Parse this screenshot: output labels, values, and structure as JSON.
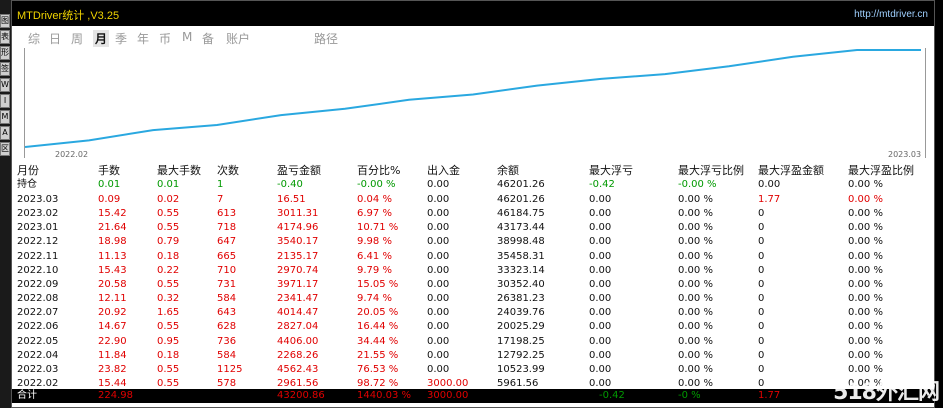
{
  "app": {
    "title": "MTDriver统计 ,V3.25",
    "url": "http://mtdriver.cn"
  },
  "left_strip": [
    "图",
    "表",
    "形",
    "签",
    "W",
    "I",
    "M",
    "A",
    "区"
  ],
  "tabs": [
    {
      "label": "综",
      "active": false
    },
    {
      "label": "日",
      "active": false
    },
    {
      "label": "周",
      "active": false
    },
    {
      "label": "月",
      "active": true
    },
    {
      "label": "季",
      "active": false
    },
    {
      "label": "年",
      "active": false
    },
    {
      "label": "币",
      "active": false
    },
    {
      "label": "M",
      "active": false
    },
    {
      "label": "备",
      "active": false
    },
    {
      "label": "账户",
      "active": false
    },
    {
      "label": "路径",
      "active": false
    }
  ],
  "chart_data": {
    "type": "line",
    "x": [
      "2022.02",
      "2022.03",
      "2022.04",
      "2022.05",
      "2022.06",
      "2022.07",
      "2022.08",
      "2022.09",
      "2022.10",
      "2022.11",
      "2022.12",
      "2023.01",
      "2023.02",
      "2023.03"
    ],
    "series": [
      {
        "values": [
          3000.0,
          5961.56,
          10523.99,
          12792.25,
          17198.25,
          20025.29,
          24039.76,
          26381.23,
          30352.4,
          33323.14,
          35458.31,
          38998.48,
          43173.44,
          46184.75,
          46201.26
        ]
      }
    ],
    "x_start_label": "2022.02",
    "x_end_label": "2023.03",
    "line_color": "#2aa8e0"
  },
  "table": {
    "headers": [
      "月份",
      "手数",
      "最大手数",
      "次数",
      "盈亏金额",
      "百分比%",
      "出入金",
      "余额",
      "最大浮亏",
      "最大浮亏比例",
      "最大浮盈金额",
      "最大浮盈比例"
    ],
    "holding": {
      "label": "持仓",
      "cells": [
        "0.01",
        "0.01",
        "1",
        "-0.40",
        "-0.00 %",
        "0.00",
        "46201.26",
        "-0.42",
        "-0.00 %",
        "0.00",
        "0.00 %"
      ]
    },
    "rows": [
      [
        "2023.03",
        "0.09",
        "0.02",
        "7",
        "16.51",
        "0.04 %",
        "0.00",
        "46201.26",
        "0.00",
        "0.00 %",
        "1.77",
        "0.00 %"
      ],
      [
        "2023.02",
        "15.42",
        "0.55",
        "613",
        "3011.31",
        "6.97 %",
        "0.00",
        "46184.75",
        "0.00",
        "0.00 %",
        "0",
        "0.00 %"
      ],
      [
        "2023.01",
        "21.64",
        "0.55",
        "718",
        "4174.96",
        "10.71 %",
        "0.00",
        "43173.44",
        "0.00",
        "0.00 %",
        "0",
        "0.00 %"
      ],
      [
        "2022.12",
        "18.98",
        "0.79",
        "647",
        "3540.17",
        "9.98 %",
        "0.00",
        "38998.48",
        "0.00",
        "0.00 %",
        "0",
        "0.00 %"
      ],
      [
        "2022.11",
        "11.13",
        "0.18",
        "665",
        "2135.17",
        "6.41 %",
        "0.00",
        "35458.31",
        "0.00",
        "0.00 %",
        "0",
        "0.00 %"
      ],
      [
        "2022.10",
        "15.43",
        "0.22",
        "710",
        "2970.74",
        "9.79 %",
        "0.00",
        "33323.14",
        "0.00",
        "0.00 %",
        "0",
        "0.00 %"
      ],
      [
        "2022.09",
        "20.58",
        "0.55",
        "731",
        "3971.17",
        "15.05 %",
        "0.00",
        "30352.40",
        "0.00",
        "0.00 %",
        "0",
        "0.00 %"
      ],
      [
        "2022.08",
        "12.11",
        "0.32",
        "584",
        "2341.47",
        "9.74 %",
        "0.00",
        "26381.23",
        "0.00",
        "0.00 %",
        "0",
        "0.00 %"
      ],
      [
        "2022.07",
        "20.92",
        "1.65",
        "643",
        "4014.47",
        "20.05 %",
        "0.00",
        "24039.76",
        "0.00",
        "0.00 %",
        "0",
        "0.00 %"
      ],
      [
        "2022.06",
        "14.67",
        "0.55",
        "628",
        "2827.04",
        "16.44 %",
        "0.00",
        "20025.29",
        "0.00",
        "0.00 %",
        "0",
        "0.00 %"
      ],
      [
        "2022.05",
        "22.90",
        "0.95",
        "736",
        "4406.00",
        "34.44 %",
        "0.00",
        "17198.25",
        "0.00",
        "0.00 %",
        "0",
        "0.00 %"
      ],
      [
        "2022.04",
        "11.84",
        "0.18",
        "584",
        "2268.26",
        "21.55 %",
        "0.00",
        "12792.25",
        "0.00",
        "0.00 %",
        "0",
        "0.00 %"
      ],
      [
        "2022.03",
        "23.82",
        "0.55",
        "1125",
        "4562.43",
        "76.53 %",
        "0.00",
        "10523.99",
        "0.00",
        "0.00 %",
        "0",
        "0.00 %"
      ],
      [
        "2022.02",
        "15.44",
        "0.55",
        "578",
        "2961.56",
        "98.72 %",
        "3000.00",
        "5961.56",
        "0.00",
        "0.00 %",
        "0",
        "0.00 %"
      ]
    ],
    "total": {
      "label": "合计",
      "lots": "224.98",
      "pnl": "43200.86",
      "pct": "1440.03 %",
      "deposit": "3000.00",
      "max_float_loss": "-0.42",
      "max_float_loss_pct": "-0 %",
      "max_float_profit": "1.77"
    }
  },
  "watermark": "518外汇网",
  "colors": {
    "title": "#f0d400",
    "profit_red": "#e00000",
    "holding_green": "#009900",
    "line": "#2aa8e0"
  }
}
